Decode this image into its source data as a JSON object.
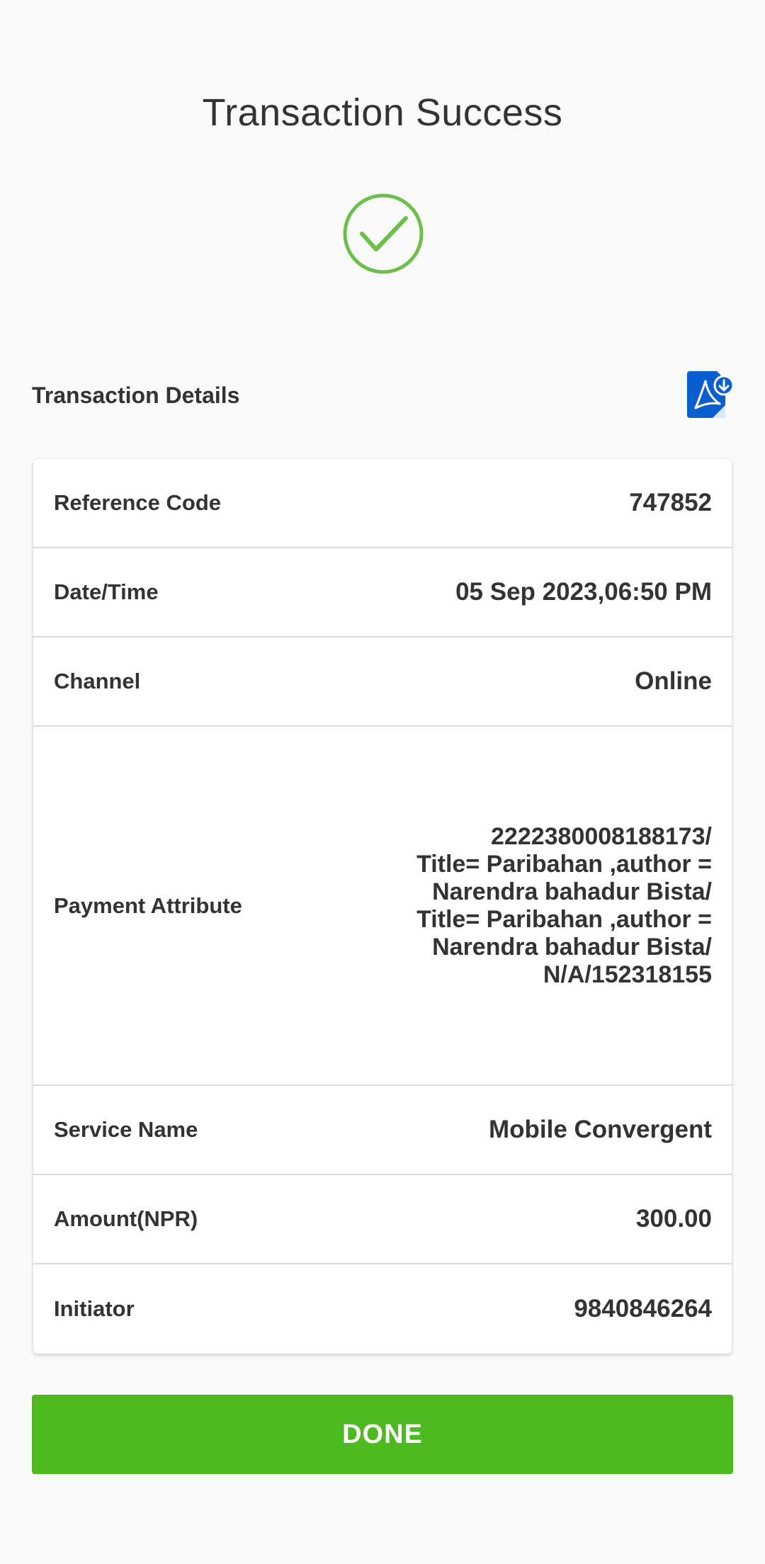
{
  "header": {
    "title": "Transaction Success"
  },
  "details": {
    "heading": "Transaction Details",
    "rows": [
      {
        "label": "Reference Code",
        "value": "747852"
      },
      {
        "label": "Date/Time",
        "value": "05 Sep 2023,06:50 PM"
      },
      {
        "label": "Channel",
        "value": "Online"
      },
      {
        "label": "Payment Attribute",
        "value": "2222380008188173/\nTitle= Paribahan ,author =\nNarendra bahadur Bista/\nTitle= Paribahan ,author =\nNarendra bahadur Bista/\nN/A/152318155"
      },
      {
        "label": "Service Name",
        "value": "Mobile Convergent"
      },
      {
        "label": "Amount(NPR)",
        "value": "300.00"
      },
      {
        "label": "Initiator",
        "value": "9840846264"
      }
    ]
  },
  "actions": {
    "done_label": "DONE"
  },
  "icons": {
    "success": "checkmark-circle-icon",
    "download_pdf": "pdf-download-icon"
  },
  "colors": {
    "accent_green": "#4cba1e",
    "check_green": "#6cc04a",
    "pdf_blue": "#0a5fd0",
    "background": "#fafafa"
  }
}
